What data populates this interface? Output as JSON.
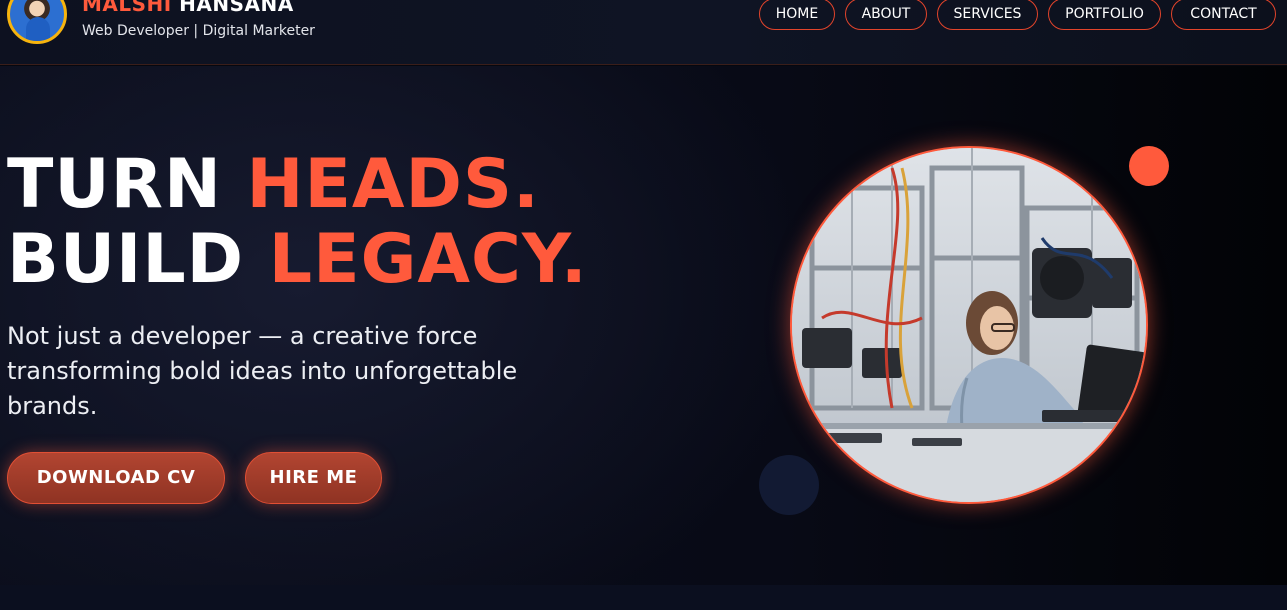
{
  "header": {
    "name_first": "MALSHI",
    "name_last": " HANSANA",
    "subtitle": "Web Developer | Digital Marketer"
  },
  "nav": {
    "items": [
      {
        "label": "HOME"
      },
      {
        "label": "ABOUT"
      },
      {
        "label": "SERVICES"
      },
      {
        "label": "PORTFOLIO"
      },
      {
        "label": "CONTACT"
      }
    ]
  },
  "hero": {
    "line1_white": "TURN ",
    "line1_accent": "HEADS.",
    "line2_white": "BUILD ",
    "line2_accent": "LEGACY.",
    "tagline": "Not just a developer — a creative force transforming bold ideas into unforgettable brands.",
    "primary_button": "DOWNLOAD CV",
    "secondary_button": "HIRE ME"
  },
  "colors": {
    "accent": "#ff5a3c",
    "background": "#05070f",
    "button_fill": "#a13c2a",
    "avatar_ring": "#f6b40e"
  },
  "icons": {
    "avatar": "profile-photo",
    "hero_image": "engineer-at-workbench-photo"
  }
}
